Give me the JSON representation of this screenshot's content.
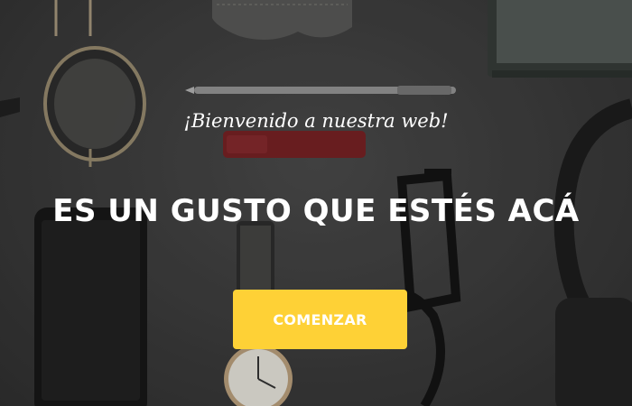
{
  "hero": {
    "subheading": "¡Bienvenido a nuestra web!",
    "heading": "ES UN GUSTO QUE ESTÉS ACÁ",
    "cta_label": "COMENZAR"
  },
  "colors": {
    "accent": "#fed136",
    "background": "#3d3d3d",
    "text": "#ffffff"
  }
}
